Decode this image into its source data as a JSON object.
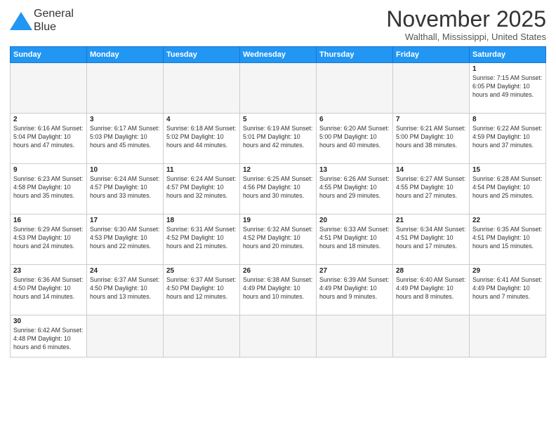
{
  "header": {
    "logo_line1": "General",
    "logo_line2": "Blue",
    "month_title": "November 2025",
    "location": "Walthall, Mississippi, United States"
  },
  "weekdays": [
    "Sunday",
    "Monday",
    "Tuesday",
    "Wednesday",
    "Thursday",
    "Friday",
    "Saturday"
  ],
  "weeks": [
    [
      {
        "day": "",
        "info": "",
        "empty": true
      },
      {
        "day": "",
        "info": "",
        "empty": true
      },
      {
        "day": "",
        "info": "",
        "empty": true
      },
      {
        "day": "",
        "info": "",
        "empty": true
      },
      {
        "day": "",
        "info": "",
        "empty": true
      },
      {
        "day": "",
        "info": "",
        "empty": true
      },
      {
        "day": "1",
        "info": "Sunrise: 7:15 AM\nSunset: 6:05 PM\nDaylight: 10 hours and 49 minutes.",
        "empty": false
      }
    ],
    [
      {
        "day": "2",
        "info": "Sunrise: 6:16 AM\nSunset: 5:04 PM\nDaylight: 10 hours and 47 minutes.",
        "empty": false
      },
      {
        "day": "3",
        "info": "Sunrise: 6:17 AM\nSunset: 5:03 PM\nDaylight: 10 hours and 45 minutes.",
        "empty": false
      },
      {
        "day": "4",
        "info": "Sunrise: 6:18 AM\nSunset: 5:02 PM\nDaylight: 10 hours and 44 minutes.",
        "empty": false
      },
      {
        "day": "5",
        "info": "Sunrise: 6:19 AM\nSunset: 5:01 PM\nDaylight: 10 hours and 42 minutes.",
        "empty": false
      },
      {
        "day": "6",
        "info": "Sunrise: 6:20 AM\nSunset: 5:00 PM\nDaylight: 10 hours and 40 minutes.",
        "empty": false
      },
      {
        "day": "7",
        "info": "Sunrise: 6:21 AM\nSunset: 5:00 PM\nDaylight: 10 hours and 38 minutes.",
        "empty": false
      },
      {
        "day": "8",
        "info": "Sunrise: 6:22 AM\nSunset: 4:59 PM\nDaylight: 10 hours and 37 minutes.",
        "empty": false
      }
    ],
    [
      {
        "day": "9",
        "info": "Sunrise: 6:23 AM\nSunset: 4:58 PM\nDaylight: 10 hours and 35 minutes.",
        "empty": false
      },
      {
        "day": "10",
        "info": "Sunrise: 6:24 AM\nSunset: 4:57 PM\nDaylight: 10 hours and 33 minutes.",
        "empty": false
      },
      {
        "day": "11",
        "info": "Sunrise: 6:24 AM\nSunset: 4:57 PM\nDaylight: 10 hours and 32 minutes.",
        "empty": false
      },
      {
        "day": "12",
        "info": "Sunrise: 6:25 AM\nSunset: 4:56 PM\nDaylight: 10 hours and 30 minutes.",
        "empty": false
      },
      {
        "day": "13",
        "info": "Sunrise: 6:26 AM\nSunset: 4:55 PM\nDaylight: 10 hours and 29 minutes.",
        "empty": false
      },
      {
        "day": "14",
        "info": "Sunrise: 6:27 AM\nSunset: 4:55 PM\nDaylight: 10 hours and 27 minutes.",
        "empty": false
      },
      {
        "day": "15",
        "info": "Sunrise: 6:28 AM\nSunset: 4:54 PM\nDaylight: 10 hours and 25 minutes.",
        "empty": false
      }
    ],
    [
      {
        "day": "16",
        "info": "Sunrise: 6:29 AM\nSunset: 4:53 PM\nDaylight: 10 hours and 24 minutes.",
        "empty": false
      },
      {
        "day": "17",
        "info": "Sunrise: 6:30 AM\nSunset: 4:53 PM\nDaylight: 10 hours and 22 minutes.",
        "empty": false
      },
      {
        "day": "18",
        "info": "Sunrise: 6:31 AM\nSunset: 4:52 PM\nDaylight: 10 hours and 21 minutes.",
        "empty": false
      },
      {
        "day": "19",
        "info": "Sunrise: 6:32 AM\nSunset: 4:52 PM\nDaylight: 10 hours and 20 minutes.",
        "empty": false
      },
      {
        "day": "20",
        "info": "Sunrise: 6:33 AM\nSunset: 4:51 PM\nDaylight: 10 hours and 18 minutes.",
        "empty": false
      },
      {
        "day": "21",
        "info": "Sunrise: 6:34 AM\nSunset: 4:51 PM\nDaylight: 10 hours and 17 minutes.",
        "empty": false
      },
      {
        "day": "22",
        "info": "Sunrise: 6:35 AM\nSunset: 4:51 PM\nDaylight: 10 hours and 15 minutes.",
        "empty": false
      }
    ],
    [
      {
        "day": "23",
        "info": "Sunrise: 6:36 AM\nSunset: 4:50 PM\nDaylight: 10 hours and 14 minutes.",
        "empty": false
      },
      {
        "day": "24",
        "info": "Sunrise: 6:37 AM\nSunset: 4:50 PM\nDaylight: 10 hours and 13 minutes.",
        "empty": false
      },
      {
        "day": "25",
        "info": "Sunrise: 6:37 AM\nSunset: 4:50 PM\nDaylight: 10 hours and 12 minutes.",
        "empty": false
      },
      {
        "day": "26",
        "info": "Sunrise: 6:38 AM\nSunset: 4:49 PM\nDaylight: 10 hours and 10 minutes.",
        "empty": false
      },
      {
        "day": "27",
        "info": "Sunrise: 6:39 AM\nSunset: 4:49 PM\nDaylight: 10 hours and 9 minutes.",
        "empty": false
      },
      {
        "day": "28",
        "info": "Sunrise: 6:40 AM\nSunset: 4:49 PM\nDaylight: 10 hours and 8 minutes.",
        "empty": false
      },
      {
        "day": "29",
        "info": "Sunrise: 6:41 AM\nSunset: 4:49 PM\nDaylight: 10 hours and 7 minutes.",
        "empty": false
      }
    ],
    [
      {
        "day": "30",
        "info": "Sunrise: 6:42 AM\nSunset: 4:48 PM\nDaylight: 10 hours and 6 minutes.",
        "empty": false
      },
      {
        "day": "",
        "info": "",
        "empty": true
      },
      {
        "day": "",
        "info": "",
        "empty": true
      },
      {
        "day": "",
        "info": "",
        "empty": true
      },
      {
        "day": "",
        "info": "",
        "empty": true
      },
      {
        "day": "",
        "info": "",
        "empty": true
      },
      {
        "day": "",
        "info": "",
        "empty": true
      }
    ]
  ]
}
